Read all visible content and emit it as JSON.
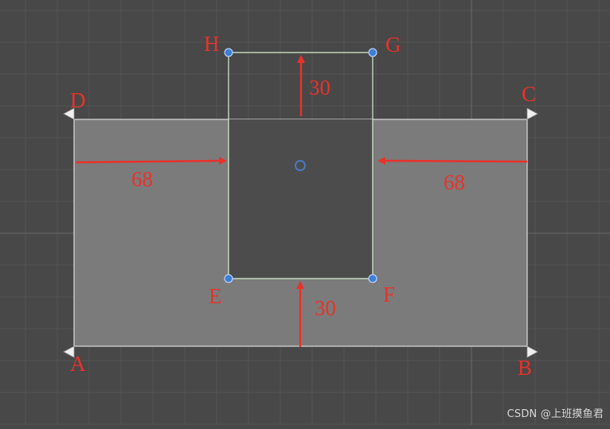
{
  "colors": {
    "background": "#484848",
    "grid": "#555555",
    "grid_axis": "#6a6a6a",
    "outer_fill": "#7b7b7b",
    "outer_edge": "#dcdcdc",
    "hole_edge": "#d8f0d0",
    "handle": "#3d7fd8",
    "annotation": "#e8322a"
  },
  "vertices": {
    "A": "A",
    "B": "B",
    "C": "C",
    "D": "D",
    "E": "E",
    "F": "F",
    "G": "G",
    "H": "H"
  },
  "dimensions": {
    "left_width": "68",
    "right_width": "68",
    "top_offset": "30",
    "bottom_offset": "30"
  },
  "icons": {
    "corner_handle": "triangle-handle-icon",
    "vertex_handle": "blue-dot-handle-icon",
    "pivot": "pivot-circle-icon"
  },
  "watermark": "CSDN @上班摸鱼君"
}
